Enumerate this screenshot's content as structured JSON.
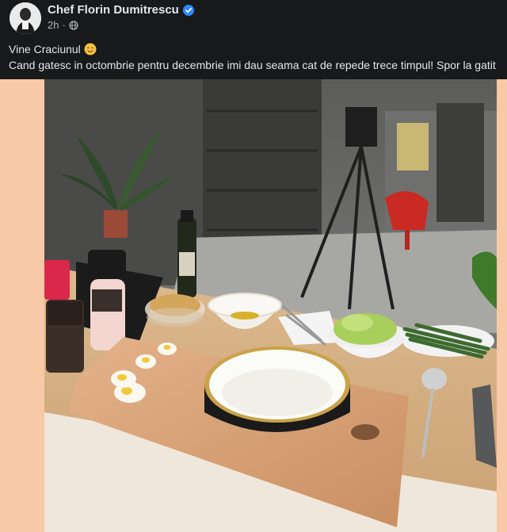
{
  "post": {
    "author": "Chef Florin Dumitrescu",
    "time": "2h",
    "line1": "Vine Craciunul",
    "line2": "Cand gatesc in octombrie pentru decembrie imi dau seama cat de repede trece timpul! Spor la gatit"
  },
  "icons": {
    "verified": "verified-badge-icon",
    "audience": "globe-icon",
    "emoji": "smiling-face-emoji"
  },
  "colors": {
    "header_bg": "#18191a",
    "text": "#e4e6eb",
    "muted": "#b0b3b8",
    "verified": "#2d88ff",
    "backdrop": "#f7c9a6"
  }
}
